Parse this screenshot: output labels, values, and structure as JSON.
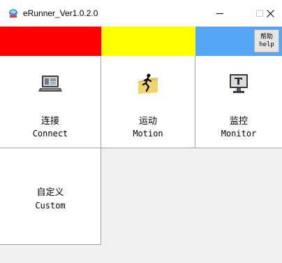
{
  "window": {
    "title": "eRunner_Ver1.0.2.0",
    "app_icon": "erunner-logo-icon",
    "controls": {
      "minimize": "minimize-icon",
      "maximize": "maximize-icon",
      "close": "close-icon"
    }
  },
  "status_bar": {
    "colors": {
      "connection": "#ff0000",
      "motion": "#ffff00",
      "monitor": "#55a5f5"
    },
    "help": {
      "label_cn": "帮助",
      "label_en": "help"
    }
  },
  "tiles": [
    {
      "icon": "laptop-icon",
      "label_cn": "连接",
      "label_en": "Connect"
    },
    {
      "icon": "running-man-icon",
      "label_cn": "运动",
      "label_en": "Motion"
    },
    {
      "icon": "monitor-icon",
      "label_cn": "监控",
      "label_en": "Monitor"
    },
    {
      "icon": "",
      "label_cn": "自定义",
      "label_en": "Custom"
    }
  ]
}
